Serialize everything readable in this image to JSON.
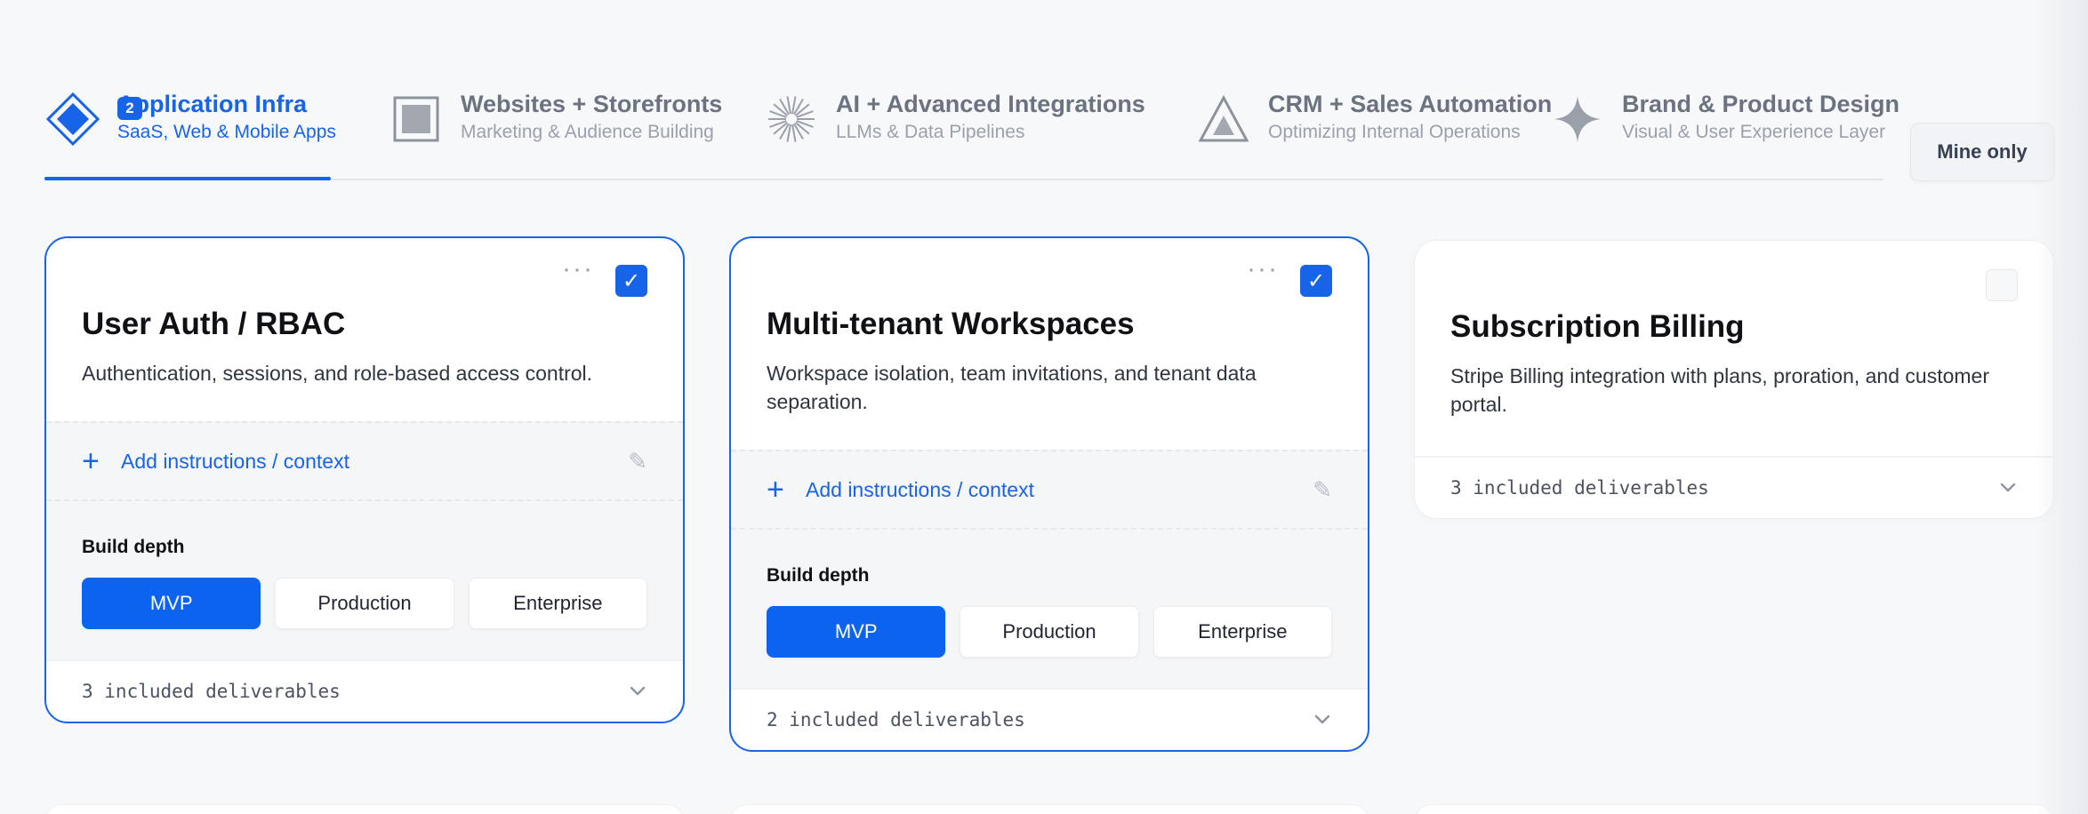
{
  "tabs": [
    {
      "title": "Application Infra",
      "subtitle": "SaaS, Web & Mobile Apps",
      "icon": "diamond-icon",
      "active": true,
      "badge": "2"
    },
    {
      "title": "Websites + Storefronts",
      "subtitle": "Marketing & Audience Building",
      "icon": "square-icon",
      "active": false
    },
    {
      "title": "AI + Advanced Integrations",
      "subtitle": "LLMs & Data Pipelines",
      "icon": "starburst-icon",
      "active": false
    },
    {
      "title": "CRM + Sales Automation",
      "subtitle": "Optimizing Internal Operations",
      "icon": "triangle-icon",
      "active": false
    },
    {
      "title": "Brand & Product Design",
      "subtitle": "Visual & User Experience Layer",
      "icon": "sparkle-icon",
      "active": false
    }
  ],
  "filter": {
    "mine_only_label": "Mine only"
  },
  "cards": [
    {
      "title": "User Auth / RBAC",
      "description": "Authentication, sessions, and role-based access control.",
      "selected": true,
      "menu_glyph": "···",
      "check_glyph": "✓",
      "add_label": "Add instructions / context",
      "plus_glyph": "+",
      "pencil_glyph": "✎",
      "depth_label": "Build depth",
      "depth_options": [
        "MVP",
        "Production",
        "Enterprise"
      ],
      "depth_selected": "MVP",
      "deliverables": "3 included deliverables"
    },
    {
      "title": "Multi-tenant Workspaces",
      "description": "Workspace isolation, team invitations, and tenant data separation.",
      "selected": true,
      "menu_glyph": "···",
      "check_glyph": "✓",
      "add_label": "Add instructions / context",
      "plus_glyph": "+",
      "pencil_glyph": "✎",
      "depth_label": "Build depth",
      "depth_options": [
        "MVP",
        "Production",
        "Enterprise"
      ],
      "depth_selected": "MVP",
      "deliverables": "2 included deliverables"
    },
    {
      "title": "Subscription Billing",
      "description": "Stripe Billing integration with plans, proration, and customer portal.",
      "selected": false,
      "deliverables": "3 included deliverables"
    }
  ],
  "colors": {
    "accent": "#1764e8",
    "primary_button": "#0b63ef",
    "muted_text": "#9aa1ab",
    "background": "#f7f8fa"
  }
}
